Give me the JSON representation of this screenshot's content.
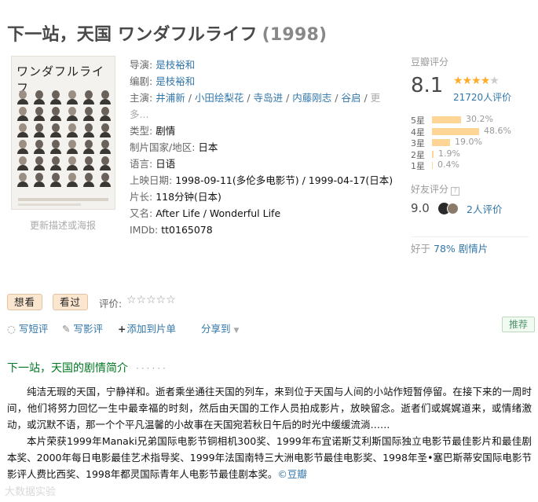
{
  "movie": {
    "title": "下一站，天国 ワンダフルライフ",
    "year": "(1998)"
  },
  "poster": {
    "title_text": "ワンダフルライフ",
    "update_link": "更新描述或海报"
  },
  "info": {
    "director_label": "导演:",
    "director": "是枝裕和",
    "writer_label": "编剧:",
    "writer": "是枝裕和",
    "cast_label": "主演:",
    "cast": [
      "井浦新",
      "小田绘梨花",
      "寺岛进",
      "内藤刚志",
      "谷启"
    ],
    "cast_more": "更多...",
    "genre_label": "类型:",
    "genre": "剧情",
    "country_label": "制片国家/地区:",
    "country": "日本",
    "language_label": "语言:",
    "language": "日语",
    "release_label": "上映日期:",
    "release_1": "1998-09-11(多伦多电影节)",
    "release_2": "1999-04-17(日本)",
    "runtime_label": "片长:",
    "runtime": "118分钟(日本)",
    "aka_label": "又名:",
    "aka": "After Life / Wonderful Life",
    "imdb_label": "IMDb:",
    "imdb": "tt0165078"
  },
  "rating": {
    "header": "豆瓣评分",
    "score": "8.1",
    "stars_filled": 4,
    "votes": "21720人评价",
    "breakdown": [
      {
        "label": "5星",
        "pct": "30.2%",
        "value": 30.2
      },
      {
        "label": "4星",
        "pct": "48.6%",
        "value": 48.6
      },
      {
        "label": "3星",
        "pct": "19.0%",
        "value": 19.0
      },
      {
        "label": "2星",
        "pct": "1.9%",
        "value": 1.9
      },
      {
        "label": "1星",
        "pct": "0.4%",
        "value": 0.4
      }
    ],
    "friends_header": "好友评分",
    "friends_help": "?",
    "friends_score": "9.0",
    "friends_votes": "2人评价",
    "better_than_prefix": "好于",
    "better_than_link": "78% 剧情片"
  },
  "actions": {
    "want": "想看",
    "seen": "看过",
    "rate_label": "评价:",
    "rate_stars": "☆☆☆☆☆"
  },
  "ops": {
    "short_review": "写短评",
    "review": "写影评",
    "add_list": "添加到片单",
    "share": "分享到",
    "recommend": "推荐"
  },
  "summary": {
    "heading": "下一站，天国的剧情简介",
    "dots": "······",
    "para1": "纯洁无瑕的天国，宁静祥和。逝者乘坐通往天国的列车，来到位于天国与人间的小站作短暂停留。在接下来的一周时间，他们将努力回忆一生中最幸福的时刻，然后由天国的工作人员拍成影片，放映留念。逝者们或娓娓道来，或情绪激动，或沉默不语，那一个个平凡温馨的小故事在天国宛若秋日午后的时光中缓缓流淌……",
    "para2": "本片荣获1999年Manaki兄弟国际电影节铜相机300奖、1999年布宜诺斯艾利斯国际独立电影节最佳影片和最佳剧本奖、2000年每日电影最佳艺术指导奖、1999年法国南特三大洲电影节最佳电影奖、1998年圣•塞巴斯蒂安国际电影节影评人费比西奖、1998年都灵国际青年人电影节最佳剧本奖。",
    "source": "©豆瓣"
  },
  "watermark": "大数据实验",
  "colors": {
    "link": "#3377aa",
    "section_green": "#007722",
    "star": "#ffac2d",
    "bar": "#ffd596",
    "button_bg": "#fbe6cf"
  }
}
